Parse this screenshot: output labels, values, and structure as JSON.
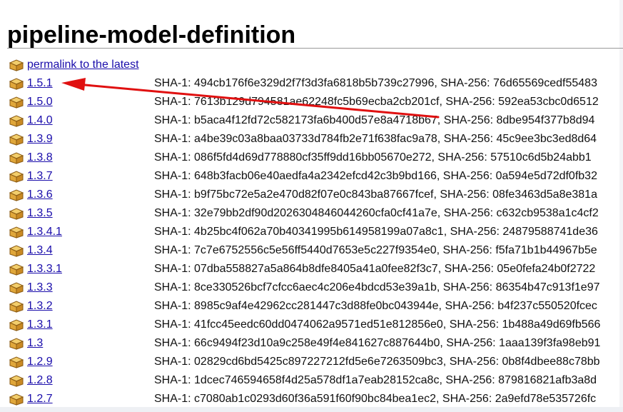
{
  "page": {
    "title": "pipeline-model-definition",
    "permalink_label": "permalink to the latest"
  },
  "releases": [
    {
      "version": "1.5.1",
      "hashes": "SHA-1: 494cb176f6e329d2f7f3d3fa6818b5b739c27996, SHA-256: 76d65569cedf55483"
    },
    {
      "version": "1.5.0",
      "hashes": "SHA-1: 7613b129d794581ae62248fc5b69ecba2cb201cf, SHA-256: 592ea53cbc0d6512"
    },
    {
      "version": "1.4.0",
      "hashes": "SHA-1: b5aca4f12fd72c582173fa6b400d57e8a4718b67, SHA-256: 8dbe954f377b8d94"
    },
    {
      "version": "1.3.9",
      "hashes": "SHA-1: a4be39c03a8baa03733d784fb2e71f638fac9a78, SHA-256: 45c9ee3bc3ed8d64"
    },
    {
      "version": "1.3.8",
      "hashes": "SHA-1: 086f5fd4d69d778880cf35ff9dd16bb05670e272, SHA-256: 57510c6d5b24abb1"
    },
    {
      "version": "1.3.7",
      "hashes": "SHA-1: 648b3facb06e40aedfa4a2342efcd42c3b9bd166, SHA-256: 0a594e5d72df0fb32"
    },
    {
      "version": "1.3.6",
      "hashes": "SHA-1: b9f75bc72e5a2e470d82f07e0c843ba87667fcef, SHA-256: 08fe3463d5a8e381a"
    },
    {
      "version": "1.3.5",
      "hashes": "SHA-1: 32e79bb2df90d2026304846044260cfa0cf41a7e, SHA-256: c632cb9538a1c4cf2"
    },
    {
      "version": "1.3.4.1",
      "hashes": "SHA-1: 4b25bc4f062a70b40341995b614958199a07a8c1, SHA-256: 24879588741de36"
    },
    {
      "version": "1.3.4",
      "hashes": "SHA-1: 7c7e6752556c5e56ff5440d7653e5c227f9354e0, SHA-256: f5fa71b1b44967b5e"
    },
    {
      "version": "1.3.3.1",
      "hashes": "SHA-1: 07dba558827a5a864b8dfe8405a41a0fee82f3c7, SHA-256: 05e0fefa24b0f2722"
    },
    {
      "version": "1.3.3",
      "hashes": "SHA-1: 8ce330526bcf7cfcc6aec4c206e4bdcd53e39a1b, SHA-256: 86354b47c913f1e97"
    },
    {
      "version": "1.3.2",
      "hashes": "SHA-1: 8985c9af4e42962cc281447c3d88fe0bc043944e, SHA-256: b4f237c550520fcec"
    },
    {
      "version": "1.3.1",
      "hashes": "SHA-1: 41fcc45eedc60dd0474062a9571ed51e812856e0, SHA-256: 1b488a49d69fb566"
    },
    {
      "version": "1.3",
      "hashes": "SHA-1: 66c9494f23d10a9c258e49f4e841627c887644b0, SHA-256: 1aaa139f3fa98eb91"
    },
    {
      "version": "1.2.9",
      "hashes": "SHA-1: 02829cd6bd5425c897227212fd5e6e7263509bc3, SHA-256: 0b8f4dbee88c78bb"
    },
    {
      "version": "1.2.8",
      "hashes": "SHA-1: 1dcec746594658f4d25a578df1a7eab28152ca8c, SHA-256: 879816821afb3a8d"
    },
    {
      "version": "1.2.7",
      "hashes": "SHA-1: c7080ab1c0293d60f36a591f60f90bc84bea1ec2, SHA-256: 2a9efd78e535726fc"
    }
  ],
  "icons": {
    "package": "package-icon",
    "annotation": "red-arrow-icon"
  },
  "colors": {
    "link": "#1a0dab",
    "annotation_arrow": "#e01010",
    "package_icon": "#d9a73a"
  }
}
